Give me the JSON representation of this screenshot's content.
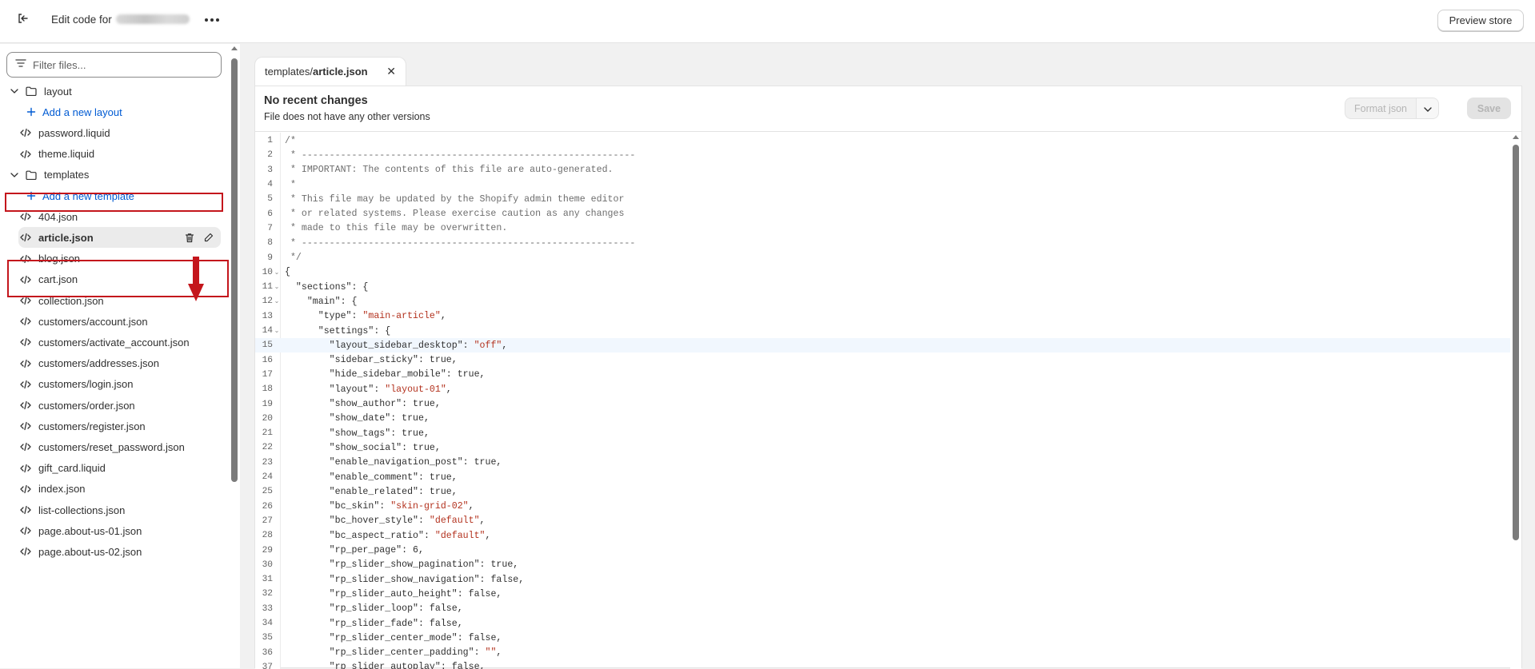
{
  "topbar": {
    "exit_icon": "exit-icon",
    "edit_prefix": "Edit code for",
    "more_icon": "more-horizontal-icon",
    "preview_label": "Preview store"
  },
  "sidebar": {
    "filter_placeholder": "Filter files...",
    "filter_icon": "filter-icon",
    "layout_folder": "layout",
    "add_layout": "Add a new layout",
    "layout_files": [
      "password.liquid",
      "theme.liquid"
    ],
    "templates_folder": "templates",
    "add_template": "Add a new template",
    "template_files": [
      "404.json",
      "article.json",
      "blog.json",
      "cart.json",
      "collection.json",
      "customers/account.json",
      "customers/activate_account.json",
      "customers/addresses.json",
      "customers/login.json",
      "customers/order.json",
      "customers/register.json",
      "customers/reset_password.json",
      "gift_card.liquid",
      "index.json",
      "list-collections.json",
      "page.about-us-01.json",
      "page.about-us-02.json"
    ],
    "active_file": "article.json",
    "highlight_color": "#c4161c"
  },
  "tab": {
    "prefix": "templates/",
    "filename": "article.json",
    "close_icon": "close-icon"
  },
  "editor": {
    "status_title": "No recent changes",
    "status_subtitle": "File does not have any other versions",
    "format_label": "Format json",
    "save_label": "Save",
    "current_line": 15,
    "lines": [
      "/*",
      " * ------------------------------------------------------------",
      " * IMPORTANT: The contents of this file are auto-generated.",
      " *",
      " * This file may be updated by the Shopify admin theme editor",
      " * or related systems. Please exercise caution as any changes",
      " * made to this file may be overwritten.",
      " * ------------------------------------------------------------",
      " */",
      "{",
      "  \"sections\": {",
      "    \"main\": {",
      "      \"type\": \"main-article\",",
      "      \"settings\": {",
      "        \"layout_sidebar_desktop\": \"off\",",
      "        \"sidebar_sticky\": true,",
      "        \"hide_sidebar_mobile\": true,",
      "        \"layout\": \"layout-01\",",
      "        \"show_author\": true,",
      "        \"show_date\": true,",
      "        \"show_tags\": true,",
      "        \"show_social\": true,",
      "        \"enable_navigation_post\": true,",
      "        \"enable_comment\": true,",
      "        \"enable_related\": true,",
      "        \"bc_skin\": \"skin-grid-02\",",
      "        \"bc_hover_style\": \"default\",",
      "        \"bc_aspect_ratio\": \"default\",",
      "        \"rp_per_page\": 6,",
      "        \"rp_slider_show_pagination\": true,",
      "        \"rp_slider_show_navigation\": false,",
      "        \"rp_slider_auto_height\": false,",
      "        \"rp_slider_loop\": false,",
      "        \"rp_slider_fade\": false,",
      "        \"rp_slider_center_mode\": false,",
      "        \"rp_slider_center_padding\": \"\",",
      "        \"rp_slider_autoplay\": false,"
    ],
    "fold_lines": [
      10,
      11,
      12,
      14
    ]
  }
}
